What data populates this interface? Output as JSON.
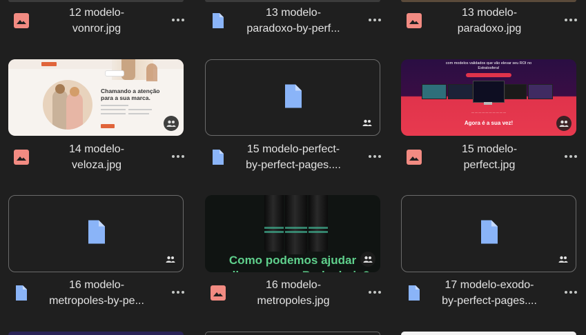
{
  "colors": {
    "background": "#1f1f1f",
    "text": "#e3e3e3",
    "doc_icon": "#8ab4f8",
    "image_icon": "#f28b82",
    "more_dots": "#c4c7c5"
  },
  "files": [
    {
      "id": "f1",
      "line1": "12 modelo-",
      "line2": "vonror.jpg",
      "icon": "image-icon"
    },
    {
      "id": "f2",
      "line1": "13 modelo-",
      "line2": "paradoxo-by-perf...",
      "icon": "doc-icon"
    },
    {
      "id": "f3",
      "line1": "13 modelo-",
      "line2": "paradoxo.jpg",
      "icon": "image-icon"
    },
    {
      "id": "f4",
      "line1": "14 modelo-",
      "line2": "veloza.jpg",
      "icon": "image-icon"
    },
    {
      "id": "f5",
      "line1": "15 modelo-perfect-",
      "line2": "by-perfect-pages....",
      "icon": "doc-icon"
    },
    {
      "id": "f6",
      "line1": "15 modelo-",
      "line2": "perfect.jpg",
      "icon": "image-icon"
    },
    {
      "id": "f7",
      "line1": "16 modelo-",
      "line2": "metropoles-by-pe...",
      "icon": "doc-icon"
    },
    {
      "id": "f8",
      "line1": "16 modelo-",
      "line2": "metropoles.jpg",
      "icon": "image-icon"
    },
    {
      "id": "f9",
      "line1": "17 modelo-exodo-",
      "line2": "by-perfect-pages....",
      "icon": "doc-icon"
    }
  ],
  "thumbs": {
    "veloza": {
      "headline": "Chamando a atenção\npara a sua marca."
    },
    "perfect": {
      "title": "com modelos validados que vão elevar seu ROI no\nEstratosfera!",
      "tagline": "Agora é a sua vez!"
    },
    "metropoles": {
      "headline": "Como podemos ajudar\nmelhorar a sua Barba hoje?"
    }
  }
}
